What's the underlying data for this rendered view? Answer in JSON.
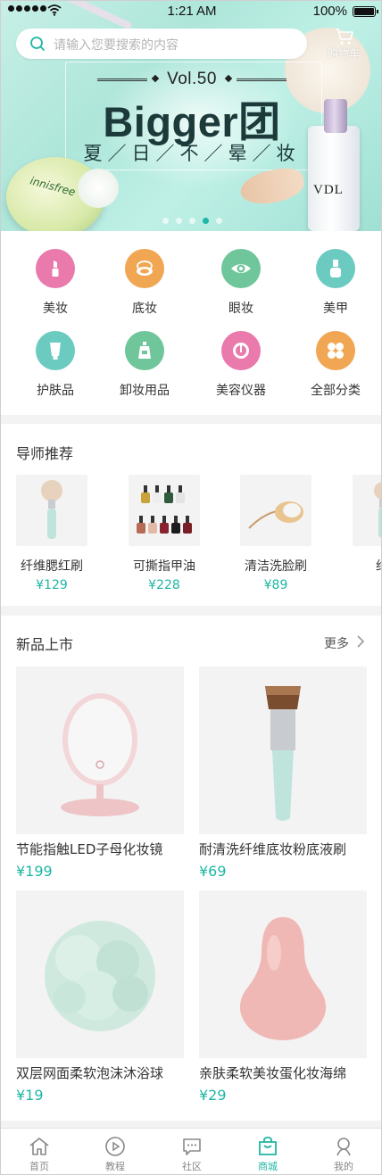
{
  "status_bar": {
    "time": "1:21 AM",
    "battery": "100%"
  },
  "banner": {
    "search_placeholder": "请输入您要搜索的内容",
    "cart_label": "购物车",
    "vol": "Vol.50",
    "title": "Bigger团",
    "subtitle": "夏／日／不／晕／妆",
    "compact_label": "innisfree",
    "bottle_label": "VDL",
    "dots": 5,
    "active_dot": 3
  },
  "colors": {
    "accent": "#1eb6a4",
    "pink": "#e97aab",
    "orange": "#f0a652",
    "green": "#6fc69a",
    "teal": "#6ccbc1"
  },
  "categories": [
    {
      "label": "美妆",
      "icon": "lipstick-icon",
      "color": "#e97aab"
    },
    {
      "label": "底妆",
      "icon": "compact-icon",
      "color": "#f0a652"
    },
    {
      "label": "眼妆",
      "icon": "eye-icon",
      "color": "#6fc69a"
    },
    {
      "label": "美甲",
      "icon": "nail-polish-icon",
      "color": "#6ccbc1"
    },
    {
      "label": "护肤品",
      "icon": "tube-icon",
      "color": "#6ccbc1"
    },
    {
      "label": "卸妆用品",
      "icon": "bottle-icon",
      "color": "#6fc69a"
    },
    {
      "label": "美容仪器",
      "icon": "device-icon",
      "color": "#e97aab"
    },
    {
      "label": "全部分类",
      "icon": "grid-flower-icon",
      "color": "#f0a652"
    }
  ],
  "tutor": {
    "title": "导师推荐",
    "items": [
      {
        "name": "纤维腮红刷",
        "price": "¥129"
      },
      {
        "name": "可撕指甲油",
        "price": "¥228"
      },
      {
        "name": "清洁洗脸刷",
        "price": "¥89"
      },
      {
        "name": "纤维",
        "price": "¥"
      }
    ]
  },
  "new_products": {
    "title": "新品上市",
    "more": "更多",
    "items": [
      {
        "name": "节能指触LED子母化妆镜",
        "price": "¥199"
      },
      {
        "name": "耐清洗纤维底妆粉底液刷",
        "price": "¥69"
      },
      {
        "name": "双层网面柔软泡沫沐浴球",
        "price": "¥19"
      },
      {
        "name": "亲肤柔软美妆蛋化妆海绵",
        "price": "¥29"
      }
    ]
  },
  "tabbar": [
    {
      "label": "首页",
      "icon": "home-icon"
    },
    {
      "label": "教程",
      "icon": "play-icon"
    },
    {
      "label": "社区",
      "icon": "chat-icon"
    },
    {
      "label": "商城",
      "icon": "shop-bag-icon",
      "active": true
    },
    {
      "label": "我的",
      "icon": "person-icon"
    }
  ]
}
